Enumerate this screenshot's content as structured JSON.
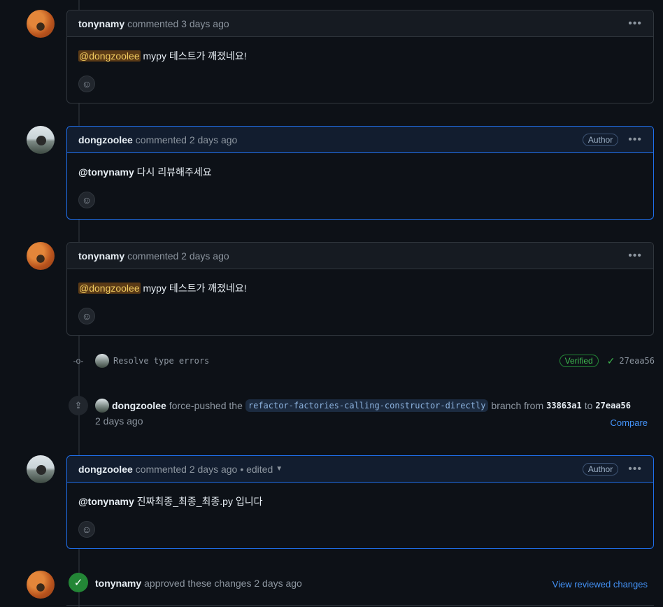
{
  "comments": [
    {
      "user": "tonynamy",
      "meta": "commented 3 days ago",
      "mention": "@dongzoolee",
      "text": " mypy 테스트가 깨졌네요!"
    },
    {
      "user": "dongzoolee",
      "meta": "commented 2 days ago",
      "badge": "Author",
      "mention": "@tonynamy",
      "text": " 다시 리뷰해주세요"
    },
    {
      "user": "tonynamy",
      "meta": "commented 2 days ago",
      "mention": "@dongzoolee",
      "text": " mypy 테스트가 깨졌네요!"
    },
    {
      "user": "dongzoolee",
      "meta": "commented 2 days ago",
      "edited": "• edited",
      "badge": "Author",
      "mention": "@tonynamy",
      "text": " 진짜최종_최종_최종.py 입니다"
    }
  ],
  "commit": {
    "message": "Resolve type errors",
    "verified": "Verified",
    "sha": "27eaa56"
  },
  "push": {
    "user": "dongzoolee",
    "action": "force-pushed the",
    "branch": "refactor-factories-calling-constructor-directly",
    "from_label": "branch from",
    "from_sha": "33863a1",
    "to_label": "to",
    "to_sha": "27eaa56",
    "time": "2 days ago",
    "compare": "Compare"
  },
  "approval": {
    "user": "tonynamy",
    "text": "approved these changes 2 days ago",
    "link": "View reviewed changes"
  },
  "icons": {
    "kebab": "kebab-horizontal-icon",
    "smiley": "smiley-icon",
    "commit": "git-commit-icon",
    "check": "check-icon",
    "push": "repo-push-icon"
  }
}
